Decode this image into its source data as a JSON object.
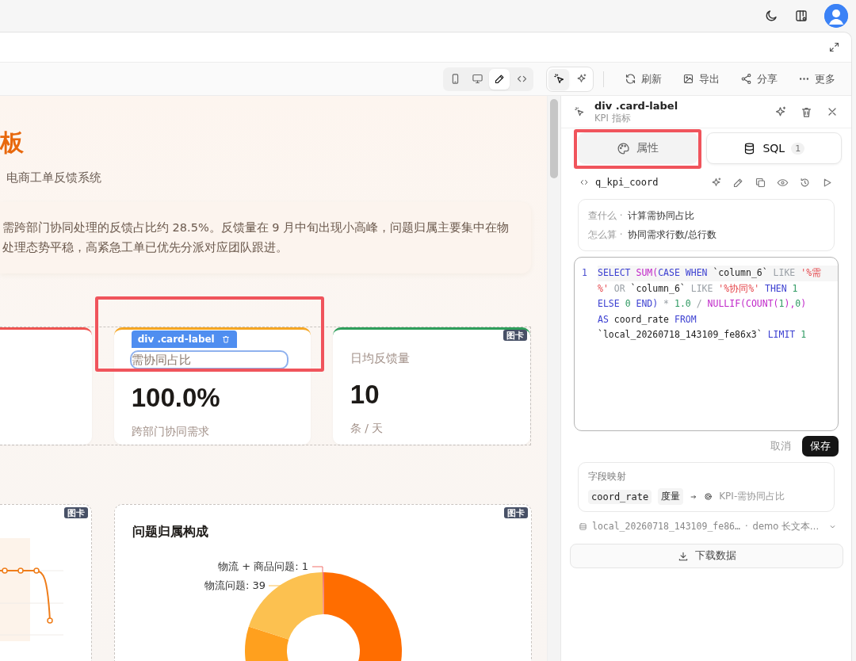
{
  "toolbar": {
    "view_modes": [
      {
        "kind": "mobile",
        "selected": false
      },
      {
        "kind": "desktop",
        "selected": false
      },
      {
        "kind": "edit",
        "selected": true
      },
      {
        "kind": "code",
        "selected": false
      }
    ],
    "pick_modes": [
      {
        "kind": "pointer",
        "selected": true
      },
      {
        "kind": "ai",
        "selected": false
      }
    ],
    "actions": [
      {
        "kind": "refresh",
        "label": "刷新"
      },
      {
        "kind": "export",
        "label": "导出"
      },
      {
        "kind": "share",
        "label": "分享"
      },
      {
        "kind": "more",
        "label": "更多"
      }
    ]
  },
  "canvas": {
    "title": "板",
    "subtitle": "电商工单反馈系统",
    "summary": [
      "需跨部门协同处理的反馈占比约 28.5%。反馈量在 9 月中旬出现小高峰，问题归属主要集中在物",
      "处理态势平稳，高紧急工单已优先分派对应团队跟进。"
    ],
    "group_badge": "图卡",
    "kpi_cards": [
      {
        "color": "#ef5350"
      },
      {
        "label": "需协同占比",
        "value": "100.0%",
        "note": "跨部门协同需求",
        "color": "#f5a623",
        "selected": true,
        "selection_tag": "div .card-label"
      },
      {
        "label": "日均反馈量",
        "value": "10",
        "note": "条 / 天",
        "color": "#2e9e5b",
        "selected": false
      }
    ],
    "chart_cards": [
      {
        "kind": "line",
        "badge": "图卡"
      },
      {
        "kind": "donut",
        "badge": "图卡",
        "title": "问题归属构成",
        "slice_labels": [
          "物流 + 商品问题: 1",
          "物流问题: 39"
        ]
      }
    ]
  },
  "panel": {
    "element": "div .card-label",
    "subtitle": "KPI 指标",
    "tabs": [
      {
        "kind": "props",
        "label": "属性",
        "selected": false
      },
      {
        "kind": "sql",
        "label": "SQL",
        "count": "1",
        "selected": true
      }
    ],
    "query_name": "q_kpi_coord",
    "info": [
      {
        "key": "查什么 ·",
        "value": "计算需协同占比"
      },
      {
        "key": "怎么算 ·",
        "value": "协同需求行数/总行数"
      }
    ],
    "sql": {
      "line_number": "1",
      "rows": [
        {
          "tokens": [
            {
              "kind": "keyword",
              "text": "SELECT "
            },
            {
              "kind": "function",
              "text": "SUM("
            },
            {
              "kind": "keyword",
              "text": "CASE WHEN "
            },
            {
              "kind": "identifier",
              "text": "`column_6` "
            },
            {
              "kind": "operator",
              "text": "LIKE "
            },
            {
              "kind": "string",
              "text": "'%需"
            }
          ]
        },
        {
          "tokens": [
            {
              "kind": "string",
              "text": "%' "
            },
            {
              "kind": "operator",
              "text": "OR "
            },
            {
              "kind": "identifier",
              "text": "`column_6` "
            },
            {
              "kind": "operator",
              "text": "LIKE "
            },
            {
              "kind": "string",
              "text": "'%协同%' "
            },
            {
              "kind": "keyword",
              "text": "THEN "
            },
            {
              "kind": "number",
              "text": "1"
            }
          ]
        },
        {
          "tokens": [
            {
              "kind": "keyword",
              "text": "ELSE "
            },
            {
              "kind": "number",
              "text": "0 "
            },
            {
              "kind": "keyword",
              "text": "END) "
            },
            {
              "kind": "operator",
              "text": "* "
            },
            {
              "kind": "number",
              "text": "1.0 "
            },
            {
              "kind": "operator",
              "text": "/ "
            },
            {
              "kind": "function",
              "text": "NULLIF(COUNT("
            },
            {
              "kind": "number",
              "text": "1"
            },
            {
              "kind": "function",
              "text": "),"
            },
            {
              "kind": "number",
              "text": "0"
            },
            {
              "kind": "function",
              "text": ")"
            }
          ]
        },
        {
          "tokens": [
            {
              "kind": "keyword",
              "text": "AS "
            },
            {
              "kind": "identifier",
              "text": "coord_rate "
            },
            {
              "kind": "keyword",
              "text": "FROM"
            }
          ]
        },
        {
          "tokens": [
            {
              "kind": "identifier",
              "text": "`local_20260718_143109_fe86x3` "
            },
            {
              "kind": "keyword",
              "text": "LIMIT "
            },
            {
              "kind": "number",
              "text": "1"
            }
          ]
        }
      ]
    },
    "cancel": "取消",
    "save": "保存",
    "mapping": {
      "title": "字段映射",
      "field": "coord_rate",
      "role": "度量",
      "target": "KPI-需协同占比"
    },
    "source": {
      "table": "local_20260718_143109_fe86…",
      "separator": "·",
      "description": "demo 长文本…"
    },
    "download": "下载数据"
  }
}
